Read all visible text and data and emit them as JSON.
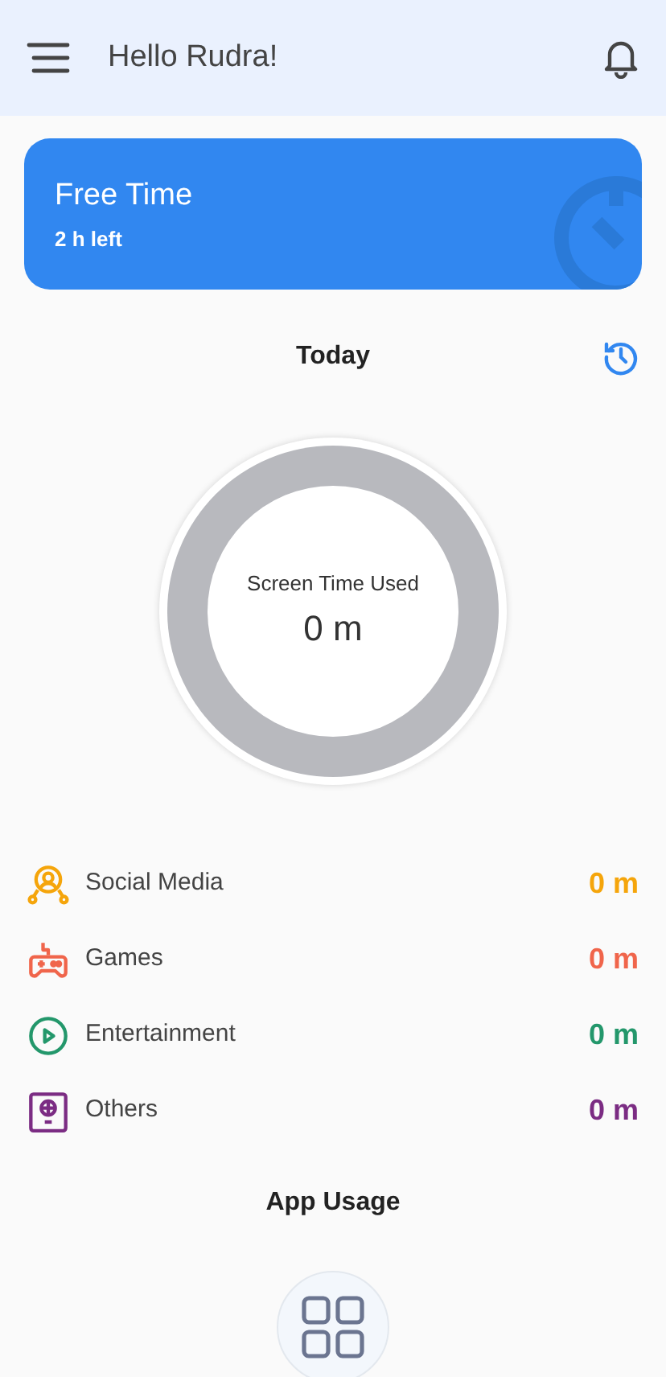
{
  "header": {
    "greeting": "Hello Rudra!"
  },
  "free_time_card": {
    "title": "Free Time",
    "subtitle": "2 h left"
  },
  "today": {
    "title": "Today",
    "donut": {
      "label": "Screen Time Used",
      "value": "0 m"
    }
  },
  "categories": [
    {
      "kind": "social",
      "name": "Social Media",
      "value": "0 m",
      "color": "#f5a50b"
    },
    {
      "kind": "games",
      "name": "Games",
      "value": "0 m",
      "color": "#f0654b"
    },
    {
      "kind": "entertainment",
      "name": "Entertainment",
      "value": "0 m",
      "color": "#23976b"
    },
    {
      "kind": "others",
      "name": "Others",
      "value": "0 m",
      "color": "#7b2c83"
    }
  ],
  "app_usage": {
    "title": "App Usage"
  }
}
